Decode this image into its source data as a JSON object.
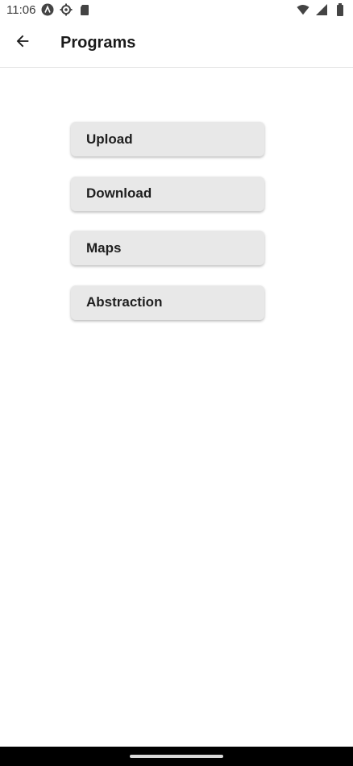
{
  "status_bar": {
    "time": "11:06",
    "left_icons": [
      "app-notification-icon",
      "settings-gear-icon",
      "sd-card-icon"
    ],
    "right_icons": [
      "wifi-icon",
      "cellular-signal-icon",
      "battery-icon"
    ]
  },
  "app_bar": {
    "back_icon": "arrow-back-icon",
    "title": "Programs"
  },
  "programs": [
    {
      "label": "Upload"
    },
    {
      "label": "Download"
    },
    {
      "label": "Maps"
    },
    {
      "label": "Abstraction"
    }
  ],
  "colors": {
    "background": "#ffffff",
    "button_background": "#e8e8e8",
    "text": "#1f1f1f",
    "nav_bar": "#000000"
  }
}
